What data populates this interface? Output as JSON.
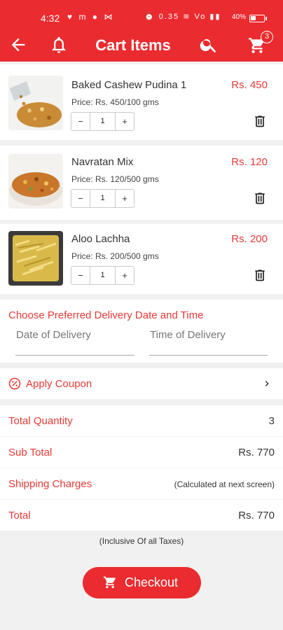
{
  "status_bar": {
    "time": "4:32",
    "left_icons": "♥ m ● ⋈",
    "right_icons": "⏰ 0.35 ≋ Vo ▮▮",
    "battery": "40%",
    "battery_level": 0.4
  },
  "app_bar": {
    "title": "Cart Items",
    "cart_count": "3"
  },
  "colors": {
    "primary": "#ea2b2f",
    "accent_text": "#e53935"
  },
  "items": [
    {
      "name": "Baked Cashew Pudina 1",
      "price": "Rs. 450",
      "unit_price": "Price: Rs. 450/100 gms",
      "quantity": "1",
      "minus": "−",
      "plus": "+"
    },
    {
      "name": "Navratan Mix",
      "price": "Rs. 120",
      "unit_price": "Price: Rs. 120/500 gms",
      "quantity": "1",
      "minus": "−",
      "plus": "+"
    },
    {
      "name": "Aloo Lachha",
      "price": "Rs. 200",
      "unit_price": "Price: Rs. 200/500 gms",
      "quantity": "1",
      "minus": "−",
      "plus": "+"
    }
  ],
  "delivery": {
    "heading": "Choose Preferred Delivery Date and Time",
    "date_placeholder": "Date of Delivery",
    "time_placeholder": "Time of Delivery"
  },
  "coupon": {
    "label": "Apply Coupon"
  },
  "summary": {
    "total_quantity_label": "Total Quantity",
    "total_quantity": "3",
    "subtotal_label": "Sub Total",
    "subtotal": "Rs. 770",
    "shipping_label": "Shipping Charges",
    "shipping": "(Calculated at next screen)",
    "total_label": "Total",
    "total": "Rs. 770"
  },
  "tax_note": "(Inclusive Of all Taxes)",
  "checkout_label": "Checkout"
}
